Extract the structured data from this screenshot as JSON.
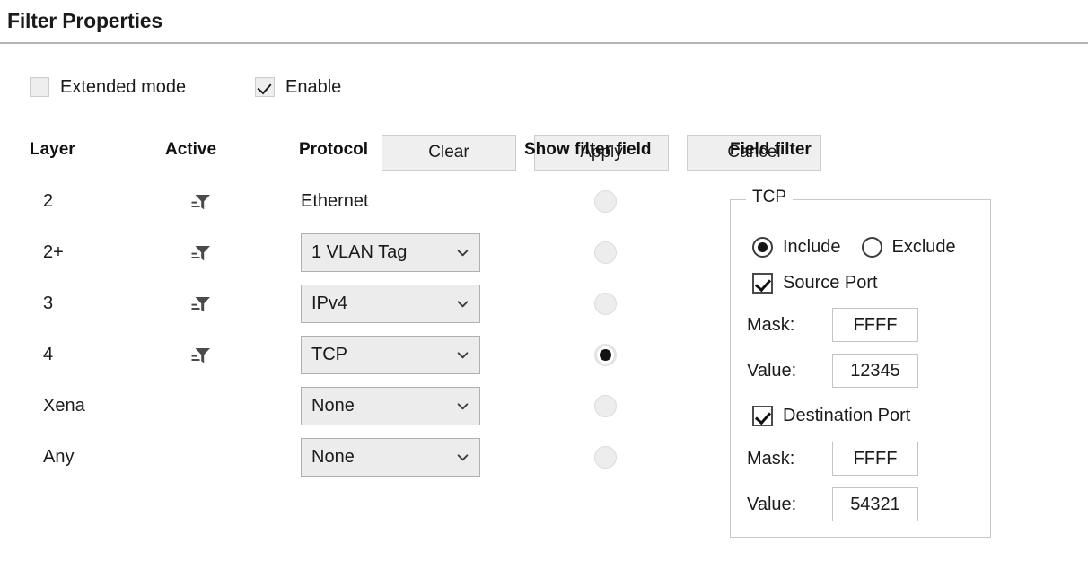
{
  "title": "Filter Properties",
  "toolbar": {
    "extended_mode": {
      "label": "Extended mode",
      "checked": false
    },
    "enable": {
      "label": "Enable",
      "checked": true
    },
    "clear_label": "Clear",
    "apply_label": "Apply",
    "cancel_label": "Cancel"
  },
  "columns": {
    "layer": "Layer",
    "active": "Active",
    "protocol": "Protocol",
    "show_filter_field": "Show filter field",
    "field_filter": "Field filter"
  },
  "rows": [
    {
      "layer": "2",
      "active_icon": "filter-funnel-icon",
      "active": true,
      "protocol": "Ethernet",
      "protocol_is_dropdown": false,
      "show_filter_field": false
    },
    {
      "layer": "2+",
      "active_icon": "filter-funnel-icon",
      "active": true,
      "protocol": "1 VLAN Tag",
      "protocol_is_dropdown": true,
      "show_filter_field": false
    },
    {
      "layer": "3",
      "active_icon": "filter-funnel-icon",
      "active": true,
      "protocol": "IPv4",
      "protocol_is_dropdown": true,
      "show_filter_field": false
    },
    {
      "layer": "4",
      "active_icon": "filter-funnel-icon",
      "active": true,
      "protocol": "TCP",
      "protocol_is_dropdown": true,
      "show_filter_field": true
    },
    {
      "layer": "Xena",
      "active_icon": null,
      "active": false,
      "protocol": "None",
      "protocol_is_dropdown": true,
      "show_filter_field": false
    },
    {
      "layer": "Any",
      "active_icon": null,
      "active": false,
      "protocol": "None",
      "protocol_is_dropdown": true,
      "show_filter_field": false
    }
  ],
  "field_filter": {
    "legend": "TCP",
    "include_label": "Include",
    "exclude_label": "Exclude",
    "mode": "Include",
    "source_port": {
      "label": "Source Port",
      "checked": true,
      "mask_label": "Mask:",
      "mask_value": "FFFF",
      "value_label": "Value:",
      "value": "12345"
    },
    "destination_port": {
      "label": "Destination Port",
      "checked": true,
      "mask_label": "Mask:",
      "mask_value": "FFFF",
      "value_label": "Value:",
      "value": "54321"
    }
  },
  "colors": {
    "text": "#1b1b1b",
    "rule": "#b4b4b4",
    "button_face": "#efefef",
    "button_border": "#cdcdcd",
    "combo_face": "#ececec",
    "combo_border": "#b0b0b0",
    "group_border": "#c8c8c8",
    "input_border": "#c4c4c4",
    "radio_selected_dot": "#121212"
  }
}
